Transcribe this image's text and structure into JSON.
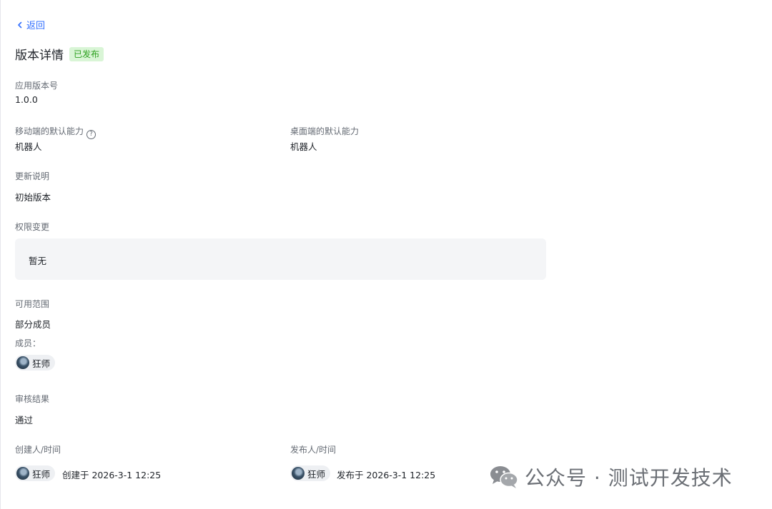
{
  "back": {
    "label": "返回"
  },
  "header": {
    "title": "版本详情",
    "status": "已发布"
  },
  "version": {
    "label": "应用版本号",
    "value": "1.0.0"
  },
  "mobile_default": {
    "label": "移动端的默认能力",
    "value": "机器人"
  },
  "desktop_default": {
    "label": "桌面端的默认能力",
    "value": "机器人"
  },
  "update_notes": {
    "label": "更新说明",
    "value": "初始版本"
  },
  "permission_change": {
    "label": "权限变更",
    "value": "暂无"
  },
  "scope": {
    "label": "可用范围",
    "value": "部分成员",
    "members_label": "成员：",
    "members": [
      "狂师"
    ]
  },
  "review": {
    "label": "审核结果",
    "value": "通过"
  },
  "creator": {
    "label": "创建人/时间",
    "name": "狂师",
    "time": "创建于 2026-3-1 12:25"
  },
  "publisher": {
    "label": "发布人/时间",
    "name": "狂师",
    "time": "发布于 2026-3-1 12:25"
  },
  "watermark": {
    "text": "公众号 · 测试开发技术"
  },
  "colors": {
    "accent": "#3370ff",
    "badge_text": "#2ea121",
    "badge_bg": "#d9f5d6"
  }
}
